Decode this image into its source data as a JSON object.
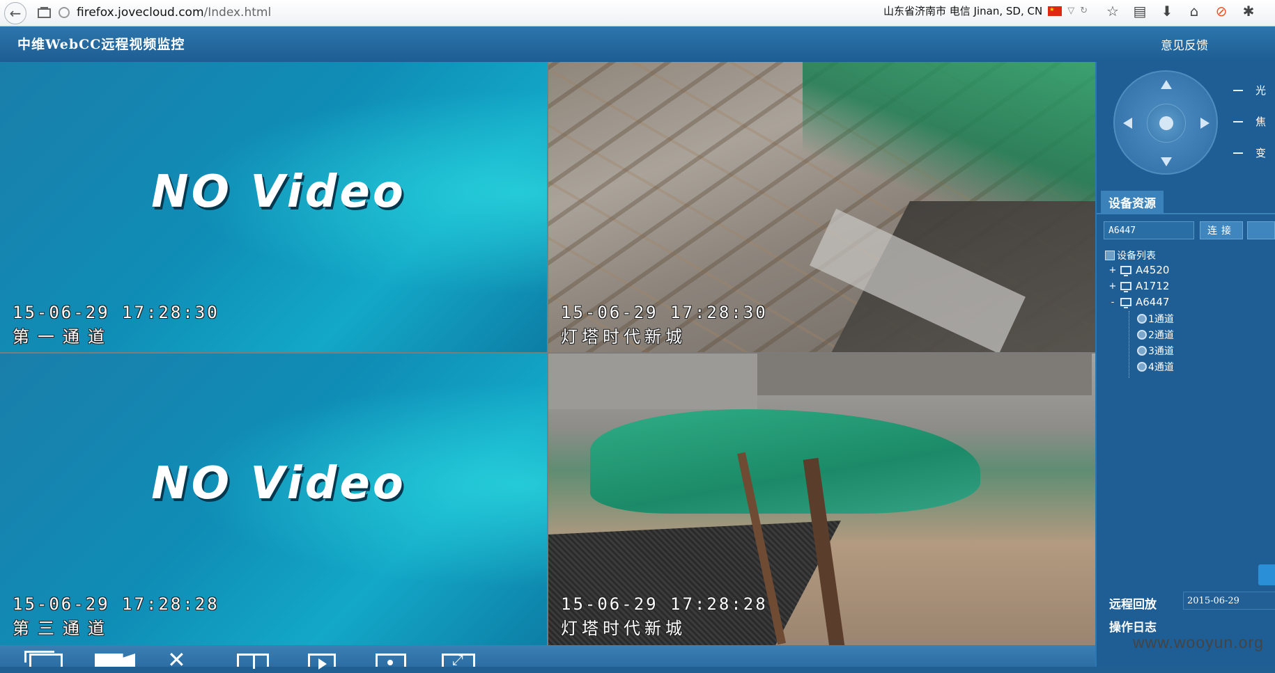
{
  "browser": {
    "url_domain": "firefox.jovecloud.com",
    "url_path": "/Index.html",
    "geo_text": "山东省济南市 电信 Jinan, SD, CN"
  },
  "app": {
    "title": "中维WebCC远程视频监控",
    "feedback": "意见反馈"
  },
  "tiles": [
    {
      "no_video": "NO Video",
      "timestamp": "15-06-29 17:28:30",
      "channel": "第一通道"
    },
    {
      "timestamp": "15-06-29 17:28:30",
      "channel": "灯塔时代新城"
    },
    {
      "no_video": "NO Video",
      "timestamp": "15-06-29 17:28:28",
      "channel": "第三通道"
    },
    {
      "timestamp": "15-06-29 17:28:28",
      "channel": "灯塔时代新城"
    }
  ],
  "panel": {
    "adjust": [
      "光",
      "焦",
      "变"
    ],
    "tab_label": "设备资源",
    "device_input_value": "A6447",
    "connect_label": "连接",
    "tree": {
      "root": "设备列表",
      "devices": [
        {
          "expander": "+",
          "name": "A4520"
        },
        {
          "expander": "+",
          "name": "A1712"
        },
        {
          "expander": "-",
          "name": "A6447"
        }
      ],
      "channels": [
        "1通道",
        "2通道",
        "3通道",
        "4通道"
      ]
    },
    "remote_playback": "远程回放",
    "date_value": "2015-06-29",
    "operation_log": "操作日志"
  },
  "watermark": "www.wooyun.org"
}
